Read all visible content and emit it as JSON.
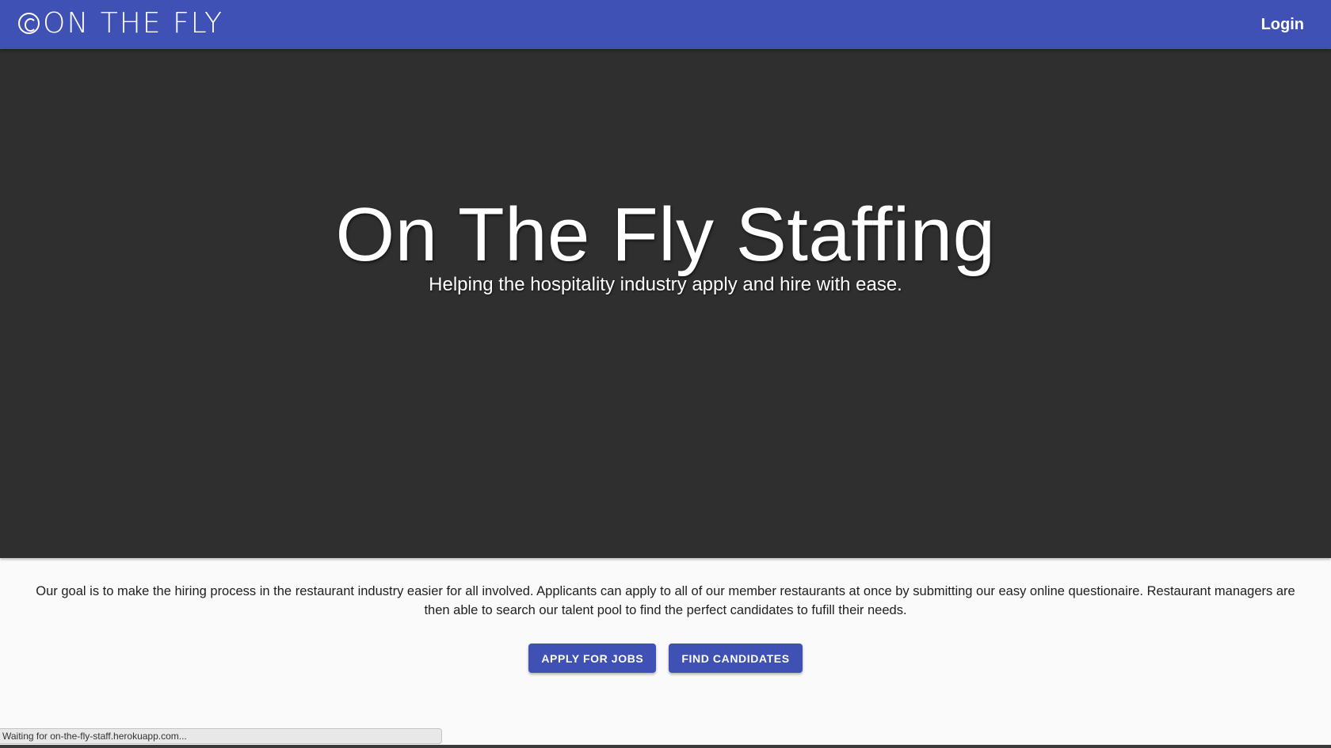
{
  "header": {
    "logo_text": "ON THE FLY",
    "login_label": "Login"
  },
  "hero": {
    "title": "On The Fly Staffing",
    "subtitle": "Helping the hospitality industry apply and hire with ease."
  },
  "main": {
    "intro": "Our goal is to make the hiring process in the restaurant industry easier for all involved. Applicants can apply to all of our member restaurants at once by submitting our easy online questionaire. Restaurant managers are then able to search our talent pool to find the perfect candidates to fufill their needs.",
    "apply_label": "APPLY FOR JOBS",
    "find_label": "FIND CANDIDATES"
  },
  "status_bar": {
    "text": "Waiting for on-the-fly-staff.herokuapp.com..."
  },
  "colors": {
    "primary": "#3f51b5",
    "hero_background": "#2f2f2f",
    "page_background": "#fafafa"
  }
}
